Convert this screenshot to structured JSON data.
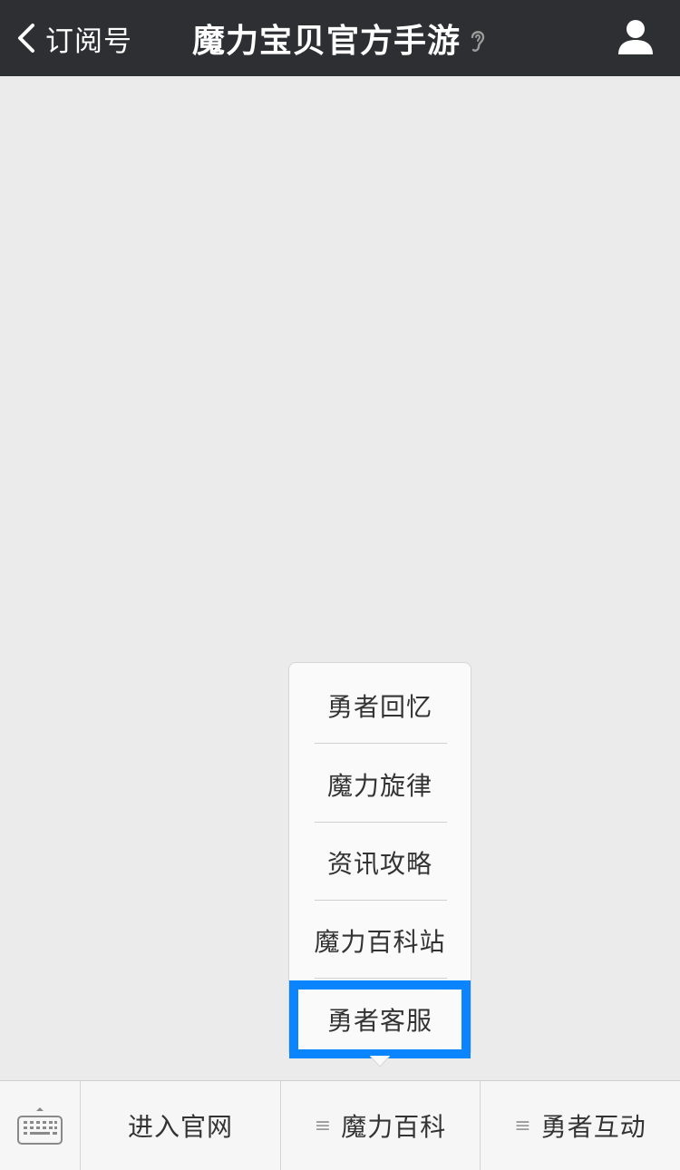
{
  "navbar": {
    "back_label": "订阅号",
    "title": "魔力宝贝官方手游"
  },
  "submenu": {
    "items": [
      {
        "label": "勇者回忆"
      },
      {
        "label": "魔力旋律"
      },
      {
        "label": "资讯攻略"
      },
      {
        "label": "魔力百科站"
      },
      {
        "label": "勇者客服"
      }
    ],
    "highlight_color": "#0a84ff"
  },
  "bottom_bar": {
    "items": [
      {
        "label": "进入官网"
      },
      {
        "label": "魔力百科",
        "icon": "menu-lines-icon"
      },
      {
        "label": "勇者互动",
        "icon": "menu-lines-icon"
      }
    ]
  },
  "colors": {
    "navbar_bg": "#2e2f33",
    "content_bg": "#ebebeb",
    "bottom_bar_bg": "#f6f6f6"
  }
}
